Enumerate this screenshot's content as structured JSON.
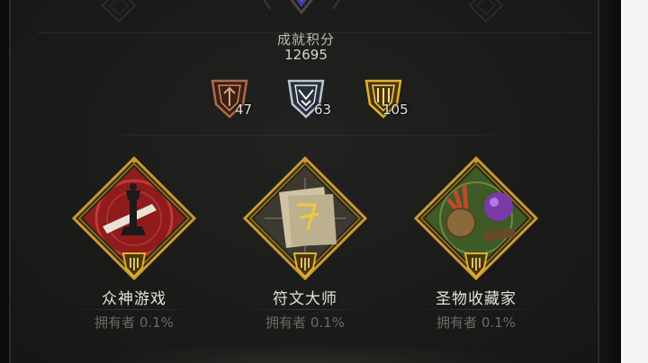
{
  "score": {
    "title": "成就积分",
    "value": "12695"
  },
  "tiers": [
    {
      "name": "bronze",
      "count": "47",
      "color": "#b06a4a"
    },
    {
      "name": "silver",
      "count": "63",
      "color": "#b9c6d4"
    },
    {
      "name": "gold",
      "count": "105",
      "color": "#e0b330"
    }
  ],
  "achievements": [
    {
      "name": "众神游戏",
      "owners": "拥有者 0.1%",
      "theme": "red",
      "icon": "crown-chess-piece-icon"
    },
    {
      "name": "符文大师",
      "owners": "拥有者 0.1%",
      "theme": "parchment",
      "icon": "rune-scroll-icon"
    },
    {
      "name": "圣物收藏家",
      "owners": "拥有者 0.1%",
      "theme": "green",
      "icon": "relic-orb-icon"
    }
  ],
  "colors": {
    "gold_frame": "#c99a2e",
    "text_primary": "#e6e2da",
    "text_muted": "#6b6963",
    "panel_bg": "#1b1b19"
  }
}
